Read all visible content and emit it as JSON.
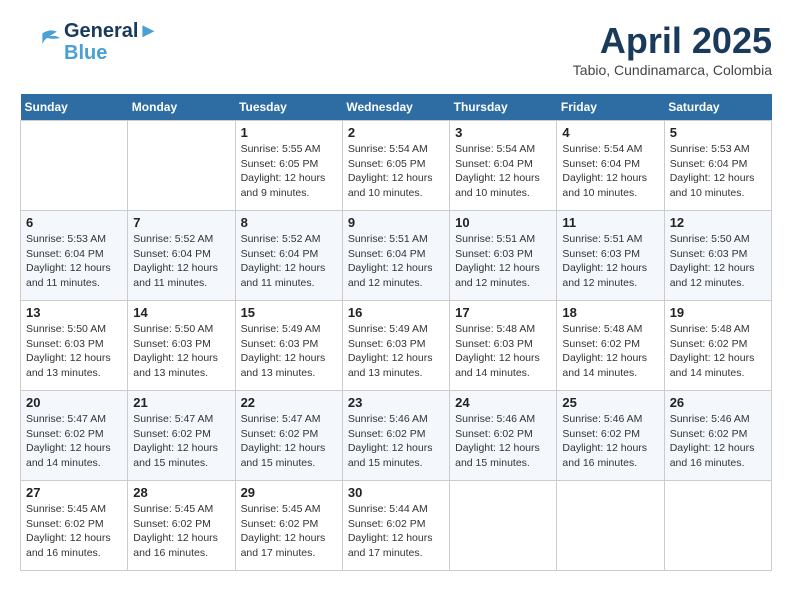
{
  "header": {
    "logo_line1": "General",
    "logo_line2": "Blue",
    "month": "April 2025",
    "location": "Tabio, Cundinamarca, Colombia"
  },
  "weekdays": [
    "Sunday",
    "Monday",
    "Tuesday",
    "Wednesday",
    "Thursday",
    "Friday",
    "Saturday"
  ],
  "weeks": [
    [
      {
        "day": "",
        "info": ""
      },
      {
        "day": "",
        "info": ""
      },
      {
        "day": "1",
        "info": "Sunrise: 5:55 AM\nSunset: 6:05 PM\nDaylight: 12 hours\nand 9 minutes."
      },
      {
        "day": "2",
        "info": "Sunrise: 5:54 AM\nSunset: 6:05 PM\nDaylight: 12 hours\nand 10 minutes."
      },
      {
        "day": "3",
        "info": "Sunrise: 5:54 AM\nSunset: 6:04 PM\nDaylight: 12 hours\nand 10 minutes."
      },
      {
        "day": "4",
        "info": "Sunrise: 5:54 AM\nSunset: 6:04 PM\nDaylight: 12 hours\nand 10 minutes."
      },
      {
        "day": "5",
        "info": "Sunrise: 5:53 AM\nSunset: 6:04 PM\nDaylight: 12 hours\nand 10 minutes."
      }
    ],
    [
      {
        "day": "6",
        "info": "Sunrise: 5:53 AM\nSunset: 6:04 PM\nDaylight: 12 hours\nand 11 minutes."
      },
      {
        "day": "7",
        "info": "Sunrise: 5:52 AM\nSunset: 6:04 PM\nDaylight: 12 hours\nand 11 minutes."
      },
      {
        "day": "8",
        "info": "Sunrise: 5:52 AM\nSunset: 6:04 PM\nDaylight: 12 hours\nand 11 minutes."
      },
      {
        "day": "9",
        "info": "Sunrise: 5:51 AM\nSunset: 6:04 PM\nDaylight: 12 hours\nand 12 minutes."
      },
      {
        "day": "10",
        "info": "Sunrise: 5:51 AM\nSunset: 6:03 PM\nDaylight: 12 hours\nand 12 minutes."
      },
      {
        "day": "11",
        "info": "Sunrise: 5:51 AM\nSunset: 6:03 PM\nDaylight: 12 hours\nand 12 minutes."
      },
      {
        "day": "12",
        "info": "Sunrise: 5:50 AM\nSunset: 6:03 PM\nDaylight: 12 hours\nand 12 minutes."
      }
    ],
    [
      {
        "day": "13",
        "info": "Sunrise: 5:50 AM\nSunset: 6:03 PM\nDaylight: 12 hours\nand 13 minutes."
      },
      {
        "day": "14",
        "info": "Sunrise: 5:50 AM\nSunset: 6:03 PM\nDaylight: 12 hours\nand 13 minutes."
      },
      {
        "day": "15",
        "info": "Sunrise: 5:49 AM\nSunset: 6:03 PM\nDaylight: 12 hours\nand 13 minutes."
      },
      {
        "day": "16",
        "info": "Sunrise: 5:49 AM\nSunset: 6:03 PM\nDaylight: 12 hours\nand 13 minutes."
      },
      {
        "day": "17",
        "info": "Sunrise: 5:48 AM\nSunset: 6:03 PM\nDaylight: 12 hours\nand 14 minutes."
      },
      {
        "day": "18",
        "info": "Sunrise: 5:48 AM\nSunset: 6:02 PM\nDaylight: 12 hours\nand 14 minutes."
      },
      {
        "day": "19",
        "info": "Sunrise: 5:48 AM\nSunset: 6:02 PM\nDaylight: 12 hours\nand 14 minutes."
      }
    ],
    [
      {
        "day": "20",
        "info": "Sunrise: 5:47 AM\nSunset: 6:02 PM\nDaylight: 12 hours\nand 14 minutes."
      },
      {
        "day": "21",
        "info": "Sunrise: 5:47 AM\nSunset: 6:02 PM\nDaylight: 12 hours\nand 15 minutes."
      },
      {
        "day": "22",
        "info": "Sunrise: 5:47 AM\nSunset: 6:02 PM\nDaylight: 12 hours\nand 15 minutes."
      },
      {
        "day": "23",
        "info": "Sunrise: 5:46 AM\nSunset: 6:02 PM\nDaylight: 12 hours\nand 15 minutes."
      },
      {
        "day": "24",
        "info": "Sunrise: 5:46 AM\nSunset: 6:02 PM\nDaylight: 12 hours\nand 15 minutes."
      },
      {
        "day": "25",
        "info": "Sunrise: 5:46 AM\nSunset: 6:02 PM\nDaylight: 12 hours\nand 16 minutes."
      },
      {
        "day": "26",
        "info": "Sunrise: 5:46 AM\nSunset: 6:02 PM\nDaylight: 12 hours\nand 16 minutes."
      }
    ],
    [
      {
        "day": "27",
        "info": "Sunrise: 5:45 AM\nSunset: 6:02 PM\nDaylight: 12 hours\nand 16 minutes."
      },
      {
        "day": "28",
        "info": "Sunrise: 5:45 AM\nSunset: 6:02 PM\nDaylight: 12 hours\nand 16 minutes."
      },
      {
        "day": "29",
        "info": "Sunrise: 5:45 AM\nSunset: 6:02 PM\nDaylight: 12 hours\nand 17 minutes."
      },
      {
        "day": "30",
        "info": "Sunrise: 5:44 AM\nSunset: 6:02 PM\nDaylight: 12 hours\nand 17 minutes."
      },
      {
        "day": "",
        "info": ""
      },
      {
        "day": "",
        "info": ""
      },
      {
        "day": "",
        "info": ""
      }
    ]
  ]
}
